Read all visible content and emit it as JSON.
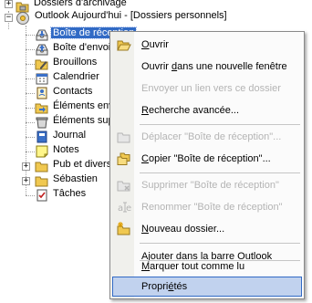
{
  "tree": {
    "items": [
      {
        "label": "Dossiers d'archivage",
        "icon": "archive-folder-icon"
      },
      {
        "label": "Outlook Aujourd'hui - [Dossiers personnels]",
        "icon": "outlook-today-icon"
      },
      {
        "label": "Boîte de réception",
        "icon": "inbox-icon",
        "selected": true
      },
      {
        "label": "Boîte d'envoi",
        "icon": "outbox-icon"
      },
      {
        "label": "Brouillons",
        "icon": "drafts-icon"
      },
      {
        "label": "Calendrier",
        "icon": "calendar-icon"
      },
      {
        "label": "Contacts",
        "icon": "contacts-icon"
      },
      {
        "label": "Éléments envoyés",
        "icon": "sent-items-icon"
      },
      {
        "label": "Éléments supprimés",
        "icon": "deleted-items-icon"
      },
      {
        "label": "Journal",
        "icon": "journal-icon"
      },
      {
        "label": "Notes",
        "icon": "notes-icon"
      },
      {
        "label": "Pub et divers",
        "icon": "folder-icon"
      },
      {
        "label": "Sébastien",
        "icon": "folder-icon"
      },
      {
        "label": "Tâches",
        "icon": "tasks-icon"
      }
    ]
  },
  "context_menu": {
    "items": [
      {
        "label": "Ouvrir",
        "underline": "O",
        "icon": "open-folder-icon",
        "enabled": true
      },
      {
        "label": "Ouvrir dans une nouvelle fenêtre",
        "underline": "d",
        "enabled": true
      },
      {
        "label": "Envoyer un lien vers ce dossier",
        "enabled": false
      },
      {
        "label": "Recherche avancée...",
        "underline": "R",
        "enabled": true
      },
      {
        "label": "Déplacer \"Boîte de réception\"...",
        "icon": "move-folder-icon",
        "enabled": false
      },
      {
        "label": "Copier \"Boîte de réception\"...",
        "underline": "C",
        "icon": "copy-folder-icon",
        "enabled": true
      },
      {
        "label": "Supprimer \"Boîte de réception\"",
        "icon": "delete-folder-icon",
        "enabled": false
      },
      {
        "label": "Renommer \"Boîte de réception\"",
        "icon": "rename-icon",
        "enabled": false
      },
      {
        "label": "Nouveau dossier...",
        "underline": "N",
        "icon": "new-folder-icon",
        "enabled": true
      },
      {
        "label": "Ajouter dans la barre Outlook",
        "enabled": true
      },
      {
        "label": "Marquer tout comme lu",
        "underline": "M",
        "enabled": true
      },
      {
        "label": "Propriétés",
        "underline": "é",
        "enabled": true,
        "highlighted": true
      }
    ]
  }
}
